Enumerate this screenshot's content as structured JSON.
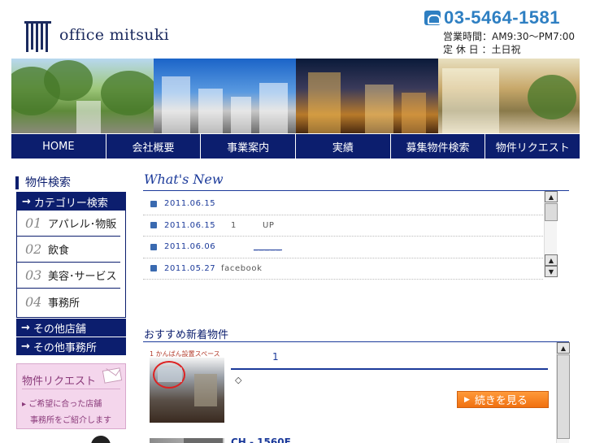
{
  "header": {
    "logo_text": "office mitsuki",
    "tel_icon": "phone-icon",
    "tel": "03-5464-1581",
    "hours": "営業時間：AM9:30〜PM7:00",
    "closed": "定 休 日 ：土日祝"
  },
  "nav": [
    {
      "label": "HOME"
    },
    {
      "label": "会社概要"
    },
    {
      "label": "事業案内"
    },
    {
      "label": "実績"
    },
    {
      "label": "募集物件検索"
    },
    {
      "label": "物件リクエスト"
    }
  ],
  "sidebar": {
    "title": "物件検索",
    "category_head": "カテゴリー検索",
    "categories": [
      {
        "num": "01",
        "label": "アパレル･物販"
      },
      {
        "num": "02",
        "label": "飲食"
      },
      {
        "num": "03",
        "label": "美容･サービス"
      },
      {
        "num": "04",
        "label": "事務所"
      }
    ],
    "other_shops": "その他店舗",
    "other_offices": "その他事務所",
    "request": {
      "title": "物件リクエスト",
      "line1": "ご希望に合った店舗",
      "line2": "事務所をご紹介します"
    }
  },
  "whats_new": {
    "title": "What's New",
    "items": [
      {
        "date": "2011.06.15",
        "text": ""
      },
      {
        "date": "2011.06.15",
        "text_a": "1",
        "text_b": "UP"
      },
      {
        "date": "2011.06.06",
        "link": "_____"
      },
      {
        "date": "2011.05.27",
        "text": "facebook"
      }
    ]
  },
  "recommended": {
    "title": "おすすめ新着物件",
    "thumb_label": "1 かんばん設置スペース",
    "item_num": "1",
    "diamond": "◇",
    "more_button": "続きを見る",
    "next_title": "CH - 1560F"
  }
}
